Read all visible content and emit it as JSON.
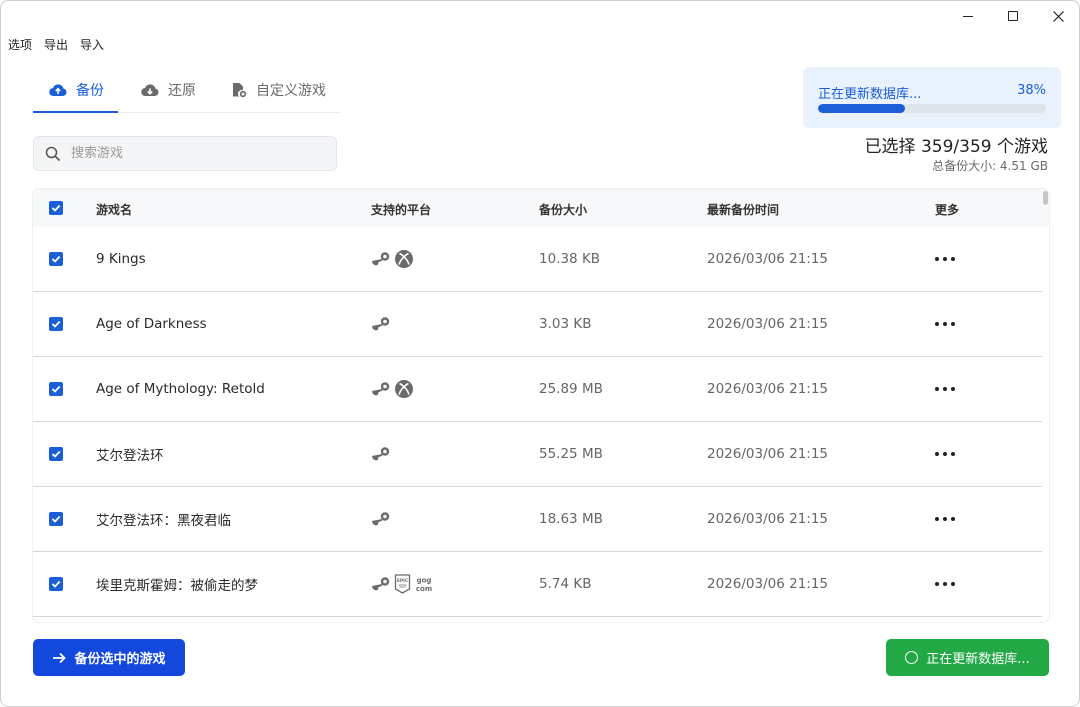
{
  "menu": [
    "选项",
    "导出",
    "导入"
  ],
  "tabs": [
    {
      "label": "备份",
      "icon": "cloud-upload-icon",
      "active": true
    },
    {
      "label": "还原",
      "icon": "cloud-download-icon",
      "active": false
    },
    {
      "label": "自定义游戏",
      "icon": "custom-game-file-icon",
      "active": false
    }
  ],
  "progress": {
    "label": "正在更新数据库...",
    "percent_text": "38%",
    "percent": 38
  },
  "summary": {
    "selected": "已选择 359/359 个游戏",
    "total_size": "总备份大小:  4.51 GB"
  },
  "search": {
    "placeholder": "搜索游戏",
    "value": ""
  },
  "table": {
    "headers": {
      "name": "游戏名",
      "platforms": "支持的平台",
      "size": "备份大小",
      "time": "最新备份时间",
      "more": "更多"
    },
    "rows": [
      {
        "name": "9 Kings",
        "platforms": [
          "steam",
          "xbox"
        ],
        "size": "10.38 KB",
        "time": "2026/03/06 21:15",
        "checked": true
      },
      {
        "name": "Age of Darkness",
        "platforms": [
          "steam"
        ],
        "size": "3.03 KB",
        "time": "2026/03/06 21:15",
        "checked": true
      },
      {
        "name": "Age of Mythology: Retold",
        "platforms": [
          "steam",
          "xbox"
        ],
        "size": "25.89 MB",
        "time": "2026/03/06 21:15",
        "checked": true
      },
      {
        "name": "艾尔登法环",
        "platforms": [
          "steam"
        ],
        "size": "55.25 MB",
        "time": "2026/03/06 21:15",
        "checked": true
      },
      {
        "name": "艾尔登法环：黑夜君临",
        "platforms": [
          "steam"
        ],
        "size": "18.63 MB",
        "time": "2026/03/06 21:15",
        "checked": true
      },
      {
        "name": "埃里克斯霍姆：被偷走的梦",
        "platforms": [
          "steam",
          "epic",
          "gog"
        ],
        "size": "5.74 KB",
        "time": "2026/03/06 21:15",
        "checked": true
      }
    ]
  },
  "buttons": {
    "backup": "备份选中的游戏",
    "update": "正在更新数据库..."
  },
  "colors": {
    "accent": "#1a5fd6",
    "primary_button": "#1248dc",
    "success_button": "#22a845",
    "progress_bg": "#e9f1fd"
  }
}
